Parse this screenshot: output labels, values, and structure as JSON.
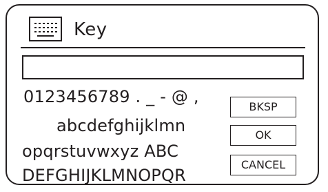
{
  "dialog": {
    "title": "Key",
    "title_icon": "keyboard-icon",
    "entry_value": ""
  },
  "keyboard": {
    "rows": [
      "0123456789 . _ - @ ,",
      "abcdefghijklmn",
      "opqrstuvwxyz ABC",
      "DEFGHIJKLMNOPQR"
    ]
  },
  "buttons": {
    "backspace": "BKSP",
    "ok": "OK",
    "cancel": "CANCEL"
  },
  "colors": {
    "ink": "#231f20",
    "background": "#ffffff"
  }
}
